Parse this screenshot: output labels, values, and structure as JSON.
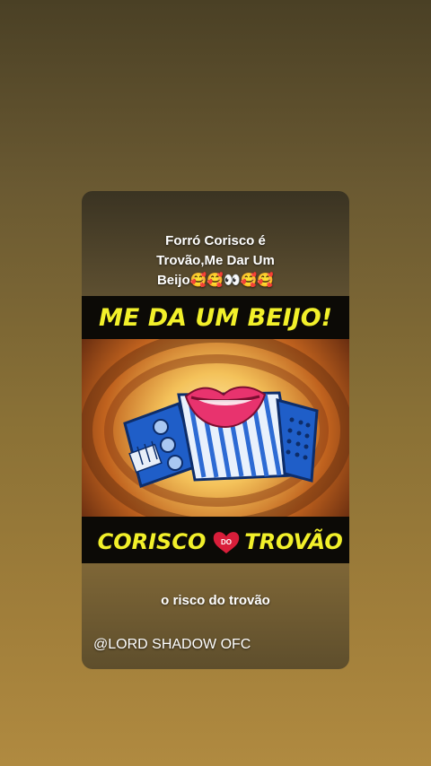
{
  "post": {
    "caption_line1": "Forró Corisco é",
    "caption_line2": "Trovão,Me Dar Um",
    "caption_line3": "Beijo🥰🥰👀🥰🥰",
    "subtitle": "o risco do trovão",
    "handle": "@LORD SHADOW OFC"
  },
  "artwork": {
    "top_text": "ME DA UM BEIJO!",
    "bottom_left": "CORISCO",
    "bottom_badge": "DO",
    "bottom_right": "TROVÃO",
    "text_color": "#f2f02a"
  },
  "icons": {
    "accordion": "accordion-icon",
    "lips": "lips-icon",
    "heart": "heart-icon"
  }
}
